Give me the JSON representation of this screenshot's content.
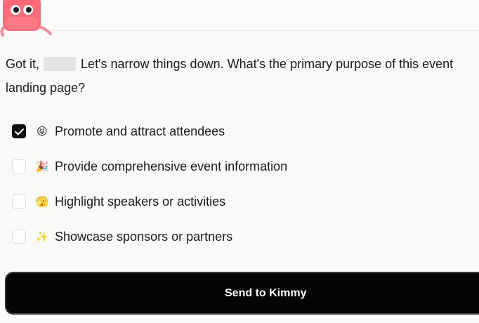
{
  "question": {
    "line1_prefix": "Got it,",
    "line1_suffix": "Let's narrow things down. What's the primary purpose of this event",
    "line2": "landing page?"
  },
  "options": [
    {
      "label": "Promote and attract attendees",
      "emoji": "😝",
      "icon": "grinning-face-icon",
      "checked": true
    },
    {
      "label": "Provide comprehensive event information",
      "emoji": "🎉",
      "icon": "party-popper-icon",
      "checked": false
    },
    {
      "label": "Highlight speakers or activities",
      "emoji": "🫣",
      "icon": "peeking-face-icon",
      "checked": false
    },
    {
      "label": "Showcase sponsors or partners",
      "emoji": "✨",
      "icon": "sparkles-icon",
      "checked": false
    }
  ],
  "send_button": {
    "label": "Send to Kimmy"
  },
  "colors": {
    "mascot": "#ff6b78",
    "button_bg": "#050505",
    "page_bg": "#f9f9f8"
  }
}
